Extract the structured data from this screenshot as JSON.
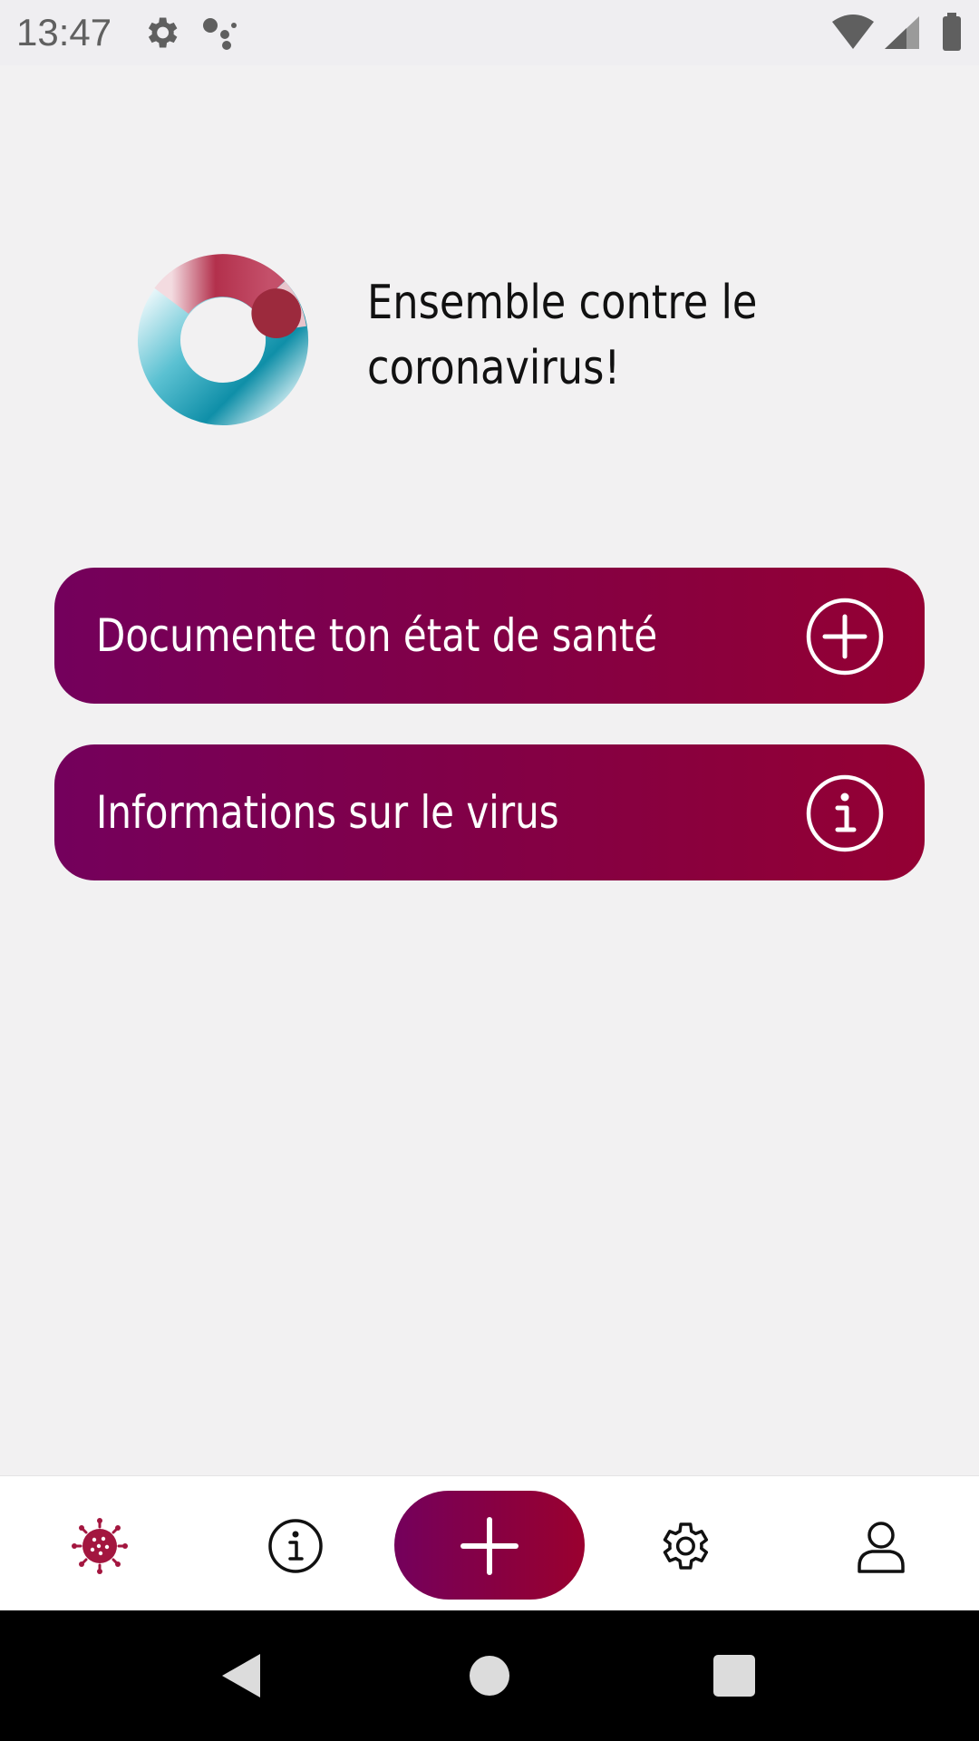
{
  "status_bar": {
    "time": "13:47",
    "icons": [
      "gear-icon",
      "assistant-dots-icon",
      "wifi-icon",
      "signal-icon",
      "battery-icon"
    ]
  },
  "hero": {
    "title": "Ensemble contre le\ncoronavirus!",
    "logo_icon": "ring-logo-icon"
  },
  "actions": [
    {
      "label": "Documente ton état de santé",
      "icon": "plus-circle-icon"
    },
    {
      "label": "Informations sur le virus",
      "icon": "info-circle-icon"
    }
  ],
  "bottom_nav": {
    "items": [
      {
        "id": "home",
        "icon": "virus-icon",
        "active": true
      },
      {
        "id": "info",
        "icon": "info-circle-icon",
        "active": false
      },
      {
        "id": "add",
        "icon": "plus-icon",
        "active": false
      },
      {
        "id": "settings",
        "icon": "gear-icon",
        "active": false
      },
      {
        "id": "profile",
        "icon": "person-icon",
        "active": false
      }
    ]
  },
  "system_nav": {
    "buttons": [
      "back-icon",
      "home-icon",
      "recents-icon"
    ]
  },
  "colors": {
    "gradient_start": "#74005c",
    "gradient_end": "#940033",
    "background": "#f2f1f2",
    "accent_red": "#a3163f"
  }
}
